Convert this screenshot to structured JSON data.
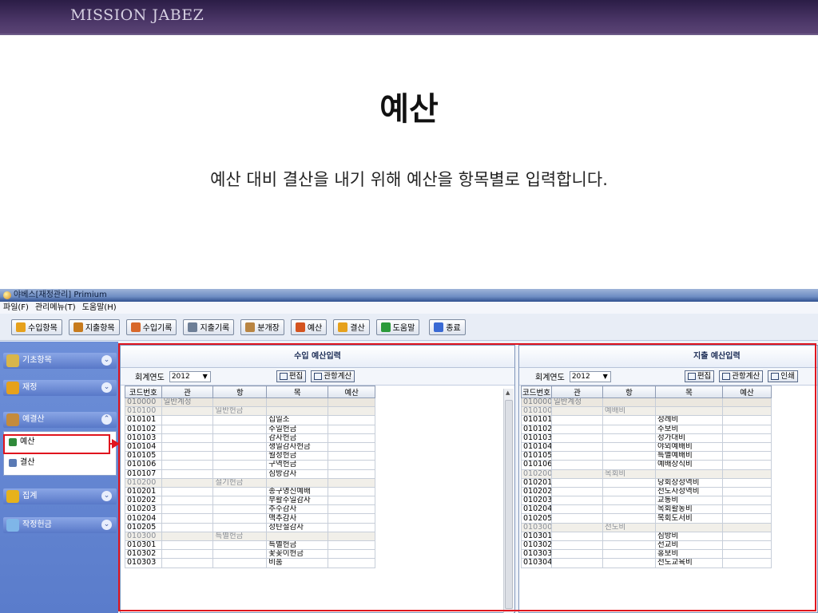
{
  "slide": {
    "brand": "MISSION JABEZ",
    "title": "예산",
    "subtitle": "예산 대비 결산을 내기 위해 예산을 항목별로 입력합니다."
  },
  "app": {
    "window_title": "야베스[재정관리]  Primium",
    "menu": [
      "파일(F)",
      "관리메뉴(T)",
      "도움말(H)"
    ],
    "toolbar": [
      {
        "label": "수입항목",
        "icon": "coins-icon",
        "color": "#e6a11c"
      },
      {
        "label": "지출항목",
        "icon": "pencil-tag-icon",
        "color": "#c77b1d"
      },
      {
        "label": "수입기록",
        "icon": "pencil-icon",
        "color": "#d8682a"
      },
      {
        "label": "지출기록",
        "icon": "check-pencil-icon",
        "color": "#6d7e96"
      },
      {
        "label": "분개장",
        "icon": "ledger-icon",
        "color": "#b98542"
      },
      {
        "label": "예산",
        "icon": "bar-chart-icon",
        "color": "#d4531f"
      },
      {
        "label": "결산",
        "icon": "coins-icon",
        "color": "#e6a11c"
      },
      {
        "label": "도움말",
        "icon": "plant-icon",
        "color": "#2b9a3a"
      },
      {
        "label": "종료",
        "icon": "exit-icon",
        "color": "#3a6ad4"
      }
    ],
    "sidebar": {
      "sections": [
        {
          "label": "기초항목",
          "icon": "notepad-icon",
          "color": "#d9b64a",
          "expanded": false
        },
        {
          "label": "재정",
          "icon": "coins-icon",
          "color": "#e6a11c",
          "expanded": false
        },
        {
          "label": "예결산",
          "icon": "money-hand-icon",
          "color": "#c48b3c",
          "expanded": true
        },
        {
          "label": "집계",
          "icon": "coins-stack-icon",
          "color": "#e6b21c",
          "expanded": false
        },
        {
          "label": "작정헌금",
          "icon": "diamond-icon",
          "color": "#7fb6e8",
          "expanded": false
        }
      ],
      "items": [
        {
          "label": "예산",
          "icon": "money-icon",
          "color": "#2f8a3a",
          "selected": true
        },
        {
          "label": "결산",
          "icon": "calc-icon",
          "color": "#5a7ab4",
          "selected": false
        }
      ]
    },
    "income_pane": {
      "title": "수입 예산입력",
      "year_label": "회계연도",
      "year": "2012",
      "buttons": [
        "편집",
        "관항계산"
      ],
      "columns": [
        "코드번호",
        "관",
        "항",
        "목",
        "예산"
      ],
      "rows": [
        {
          "code": "010000",
          "gwan": "일반계정",
          "hang": "",
          "mok": "",
          "budget": "",
          "kind": "top"
        },
        {
          "code": "010100",
          "gwan": "",
          "hang": "일반헌금",
          "mok": "",
          "budget": "",
          "kind": "group"
        },
        {
          "code": "010101",
          "gwan": "",
          "hang": "",
          "mok": "십일조",
          "budget": "",
          "kind": "item"
        },
        {
          "code": "010102",
          "gwan": "",
          "hang": "",
          "mok": "주일헌금",
          "budget": "",
          "kind": "item"
        },
        {
          "code": "010103",
          "gwan": "",
          "hang": "",
          "mok": "감사헌금",
          "budget": "",
          "kind": "item"
        },
        {
          "code": "010104",
          "gwan": "",
          "hang": "",
          "mok": "생일감사헌금",
          "budget": "",
          "kind": "item"
        },
        {
          "code": "010105",
          "gwan": "",
          "hang": "",
          "mok": "월정헌금",
          "budget": "",
          "kind": "item"
        },
        {
          "code": "010106",
          "gwan": "",
          "hang": "",
          "mok": "구역헌금",
          "budget": "",
          "kind": "item"
        },
        {
          "code": "010107",
          "gwan": "",
          "hang": "",
          "mok": "심방감사",
          "budget": "",
          "kind": "item"
        },
        {
          "code": "010200",
          "gwan": "",
          "hang": "절기헌금",
          "mok": "",
          "budget": "",
          "kind": "group"
        },
        {
          "code": "010201",
          "gwan": "",
          "hang": "",
          "mok": "송구영신예배",
          "budget": "",
          "kind": "item"
        },
        {
          "code": "010202",
          "gwan": "",
          "hang": "",
          "mok": "부활주일감사",
          "budget": "",
          "kind": "item"
        },
        {
          "code": "010203",
          "gwan": "",
          "hang": "",
          "mok": "추수감사",
          "budget": "",
          "kind": "item"
        },
        {
          "code": "010204",
          "gwan": "",
          "hang": "",
          "mok": "맥추감사",
          "budget": "",
          "kind": "item"
        },
        {
          "code": "010205",
          "gwan": "",
          "hang": "",
          "mok": "성탄절감사",
          "budget": "",
          "kind": "item"
        },
        {
          "code": "010300",
          "gwan": "",
          "hang": "특별헌금",
          "mok": "",
          "budget": "",
          "kind": "group"
        },
        {
          "code": "010301",
          "gwan": "",
          "hang": "",
          "mok": "특별헌금",
          "budget": "",
          "kind": "item"
        },
        {
          "code": "010302",
          "gwan": "",
          "hang": "",
          "mok": "꽃꽂이헌금",
          "budget": "",
          "kind": "item"
        },
        {
          "code": "010303",
          "gwan": "",
          "hang": "",
          "mok": "비품",
          "budget": "",
          "kind": "item"
        }
      ]
    },
    "expense_pane": {
      "title": "지출 예산입력",
      "year_label": "회계연도",
      "year": "2012",
      "buttons": [
        "편집",
        "관항계산",
        "인쇄"
      ],
      "columns": [
        "코드번호",
        "관",
        "항",
        "목",
        "예산"
      ],
      "rows": [
        {
          "code": "010000",
          "gwan": "일반계정",
          "hang": "",
          "mok": "",
          "budget": "",
          "kind": "top"
        },
        {
          "code": "010100",
          "gwan": "",
          "hang": "예배비",
          "mok": "",
          "budget": "",
          "kind": "group"
        },
        {
          "code": "010101",
          "gwan": "",
          "hang": "",
          "mok": "성례비",
          "budget": "",
          "kind": "item"
        },
        {
          "code": "010102",
          "gwan": "",
          "hang": "",
          "mok": "주보비",
          "budget": "",
          "kind": "item"
        },
        {
          "code": "010103",
          "gwan": "",
          "hang": "",
          "mok": "성가대비",
          "budget": "",
          "kind": "item"
        },
        {
          "code": "010104",
          "gwan": "",
          "hang": "",
          "mok": "야외예배비",
          "budget": "",
          "kind": "item"
        },
        {
          "code": "010105",
          "gwan": "",
          "hang": "",
          "mok": "특별예배비",
          "budget": "",
          "kind": "item"
        },
        {
          "code": "010106",
          "gwan": "",
          "hang": "",
          "mok": "예배장식비",
          "budget": "",
          "kind": "item"
        },
        {
          "code": "010200",
          "gwan": "",
          "hang": "목회비",
          "mok": "",
          "budget": "",
          "kind": "group"
        },
        {
          "code": "010201",
          "gwan": "",
          "hang": "",
          "mok": "당회장성역비",
          "budget": "",
          "kind": "item"
        },
        {
          "code": "010202",
          "gwan": "",
          "hang": "",
          "mok": "전도사성역비",
          "budget": "",
          "kind": "item"
        },
        {
          "code": "010203",
          "gwan": "",
          "hang": "",
          "mok": "교통비",
          "budget": "",
          "kind": "item"
        },
        {
          "code": "010204",
          "gwan": "",
          "hang": "",
          "mok": "목회활동비",
          "budget": "",
          "kind": "item"
        },
        {
          "code": "010205",
          "gwan": "",
          "hang": "",
          "mok": "목회도서비",
          "budget": "",
          "kind": "item"
        },
        {
          "code": "010300",
          "gwan": "",
          "hang": "전도비",
          "mok": "",
          "budget": "",
          "kind": "group"
        },
        {
          "code": "010301",
          "gwan": "",
          "hang": "",
          "mok": "심방비",
          "budget": "",
          "kind": "item"
        },
        {
          "code": "010302",
          "gwan": "",
          "hang": "",
          "mok": "선교비",
          "budget": "",
          "kind": "item"
        },
        {
          "code": "010303",
          "gwan": "",
          "hang": "",
          "mok": "홍보비",
          "budget": "",
          "kind": "item"
        },
        {
          "code": "010304",
          "gwan": "",
          "hang": "",
          "mok": "전도교육비",
          "budget": "",
          "kind": "item"
        }
      ]
    },
    "accent_color": "#e0141e"
  }
}
